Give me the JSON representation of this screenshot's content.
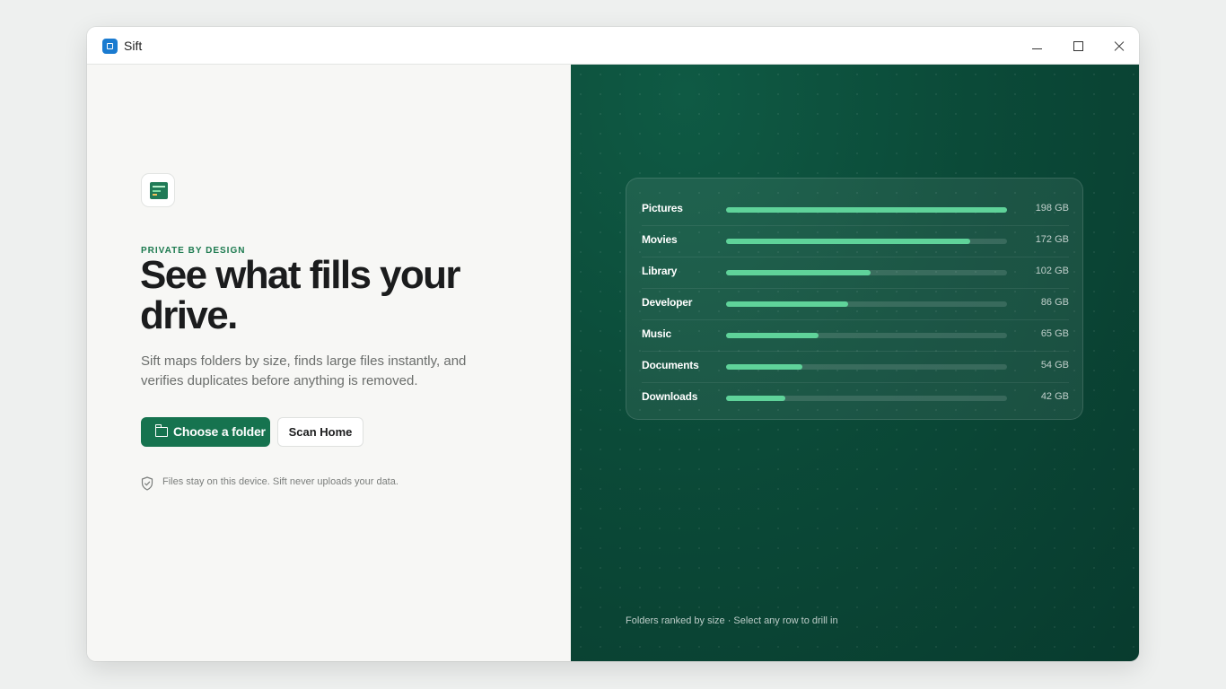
{
  "window": {
    "app_name": "Sift"
  },
  "hero": {
    "eyebrow": "PRIVATE BY DESIGN",
    "headline": "See what fills your drive.",
    "lede": "Sift maps folders by size, finds large files instantly, and verifies duplicates before anything is removed.",
    "primary_button": "Choose a folder",
    "secondary_button": "Scan Home",
    "privacy_note": "Files stay on this device. Sift never uploads your data."
  },
  "preview": {
    "folders": [
      {
        "name": "Pictures",
        "size": "198 GB",
        "gb": 198
      },
      {
        "name": "Movies",
        "size": "172 GB",
        "gb": 172
      },
      {
        "name": "Library",
        "size": "102 GB",
        "gb": 102
      },
      {
        "name": "Developer",
        "size": "86 GB",
        "gb": 86
      },
      {
        "name": "Music",
        "size": "65 GB",
        "gb": 65
      },
      {
        "name": "Documents",
        "size": "54 GB",
        "gb": 54
      },
      {
        "name": "Downloads",
        "size": "42 GB",
        "gb": 42
      }
    ],
    "max_gb": 198,
    "footnote": "Folders ranked by size · Select any row to drill in"
  },
  "colors": {
    "accent": "#16734f",
    "bar_fill": "#5fd39a",
    "panel_bg": "#0b4a38"
  }
}
